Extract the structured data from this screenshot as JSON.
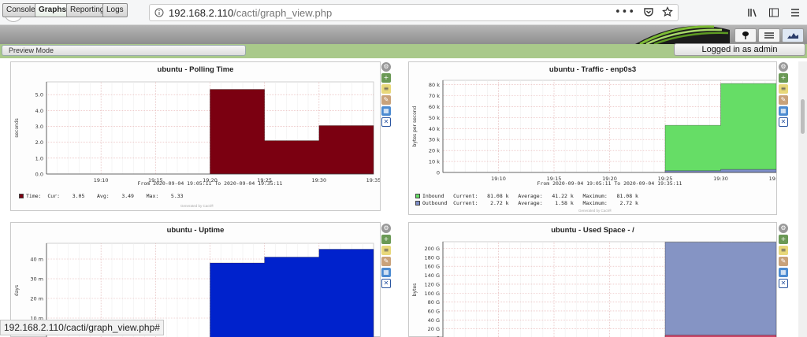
{
  "browser": {
    "url_host": "192.168.2.110",
    "url_path": "/cacti/graph_view.php"
  },
  "cacti": {
    "tabs": [
      "Console",
      "Graphs",
      "Reporting",
      "Logs"
    ],
    "active_tab": "Graphs",
    "preview_mode": "Preview Mode",
    "logged_in": "Logged in as admin"
  },
  "status_bar": "192.168.2.110/cacti/graph_view.php#",
  "graphs": [
    {
      "title": "ubuntu - Polling Time",
      "ylabel": "seconds",
      "period": "From 2020-09-04 19:05:11 To 2020-09-04 19:35:11",
      "generator": "Generated by Cacti®",
      "legend": [
        {
          "text": "Time:  Cur:    3.05    Avg:    3.49    Max:    5.33",
          "color": "#7b0011"
        }
      ]
    },
    {
      "title": "ubuntu - Traffic - enp0s3",
      "ylabel": "bytes per second",
      "period": "From 2020-09-04 19:05:11 To 2020-09-04 19:35:11",
      "generator": "Generated by Cacti®",
      "legend": [
        {
          "text": "Inbound   Current:   81.08 k   Average:   41.22 k   Maximum:   81.08 k",
          "color": "#66dd66"
        },
        {
          "text": "Outbound  Current:    2.72 k   Average:    1.58 k   Maximum:    2.72 k",
          "color": "#7e8ec9"
        }
      ]
    },
    {
      "title": "ubuntu - Uptime",
      "ylabel": "days"
    },
    {
      "title": "ubuntu - Used Space - /",
      "ylabel": "bytes"
    }
  ],
  "chart_data": [
    {
      "type": "area",
      "title": "ubuntu - Polling Time",
      "ylabel": "seconds",
      "x_ticks": [
        "19:10",
        "19:15",
        "19:20",
        "19:25",
        "19:30",
        "19:35"
      ],
      "y_ticks": [
        "0.0",
        "1.0",
        "2.0",
        "3.0",
        "4.0",
        "5.0"
      ],
      "ylim": [
        0,
        5.8
      ],
      "xlim": [
        "19:05",
        "19:35"
      ],
      "series": [
        {
          "name": "Time",
          "color": "#7b0011",
          "x": [
            "19:20",
            "19:25",
            "19:25",
            "19:30",
            "19:30",
            "19:35"
          ],
          "values": [
            5.33,
            5.33,
            2.1,
            2.1,
            3.05,
            3.05
          ]
        }
      ]
    },
    {
      "type": "area",
      "title": "ubuntu - Traffic - enp0s3",
      "ylabel": "bytes per second",
      "x_ticks": [
        "19:10",
        "19:15",
        "19:20",
        "19:25",
        "19:30",
        "19:35"
      ],
      "y_ticks": [
        "0",
        "10 k",
        "20 k",
        "30 k",
        "40 k",
        "50 k",
        "60 k",
        "70 k",
        "80 k"
      ],
      "ylim": [
        0,
        84000
      ],
      "xlim": [
        "19:05",
        "19:35"
      ],
      "series": [
        {
          "name": "Inbound",
          "color": "#66dd66",
          "x": [
            "19:25",
            "19:30",
            "19:30",
            "19:35"
          ],
          "values": [
            43000,
            43000,
            81080,
            81080
          ]
        },
        {
          "name": "Outbound",
          "color": "#7e8ec9",
          "x": [
            "19:25",
            "19:30",
            "19:30",
            "19:35"
          ],
          "values": [
            1580,
            1580,
            2720,
            2720
          ]
        }
      ]
    },
    {
      "type": "area",
      "title": "ubuntu - Uptime",
      "ylabel": "days",
      "x_ticks": [],
      "y_ticks": [
        "10 m",
        "20 m",
        "30 m",
        "40 m"
      ],
      "y_tick_values": [
        10,
        20,
        30,
        40
      ],
      "ylim": [
        0,
        48
      ],
      "xlim": [
        "19:05",
        "19:35"
      ],
      "series": [
        {
          "color": "#0022cc",
          "x": [
            "19:20",
            "19:25",
            "19:25",
            "19:30",
            "19:30",
            "19:35"
          ],
          "values": [
            38,
            38,
            41,
            41,
            45,
            45
          ]
        }
      ]
    },
    {
      "type": "area",
      "title": "ubuntu - Used Space - /",
      "ylabel": "bytes",
      "x_ticks": [],
      "y_ticks": [
        "0",
        "20 G",
        "40 G",
        "60 G",
        "80 G",
        "100 G",
        "120 G",
        "140 G",
        "160 G",
        "180 G",
        "200 G"
      ],
      "ylim": [
        0,
        215
      ],
      "xlim": [
        "19:05",
        "19:35"
      ],
      "series": [
        {
          "color": "#8594c4",
          "x": [
            "19:25",
            "19:35"
          ],
          "values": [
            214,
            214
          ]
        },
        {
          "color": "#cc4466",
          "x": [
            "19:25",
            "19:35"
          ],
          "values": [
            6,
            6
          ]
        }
      ]
    }
  ]
}
